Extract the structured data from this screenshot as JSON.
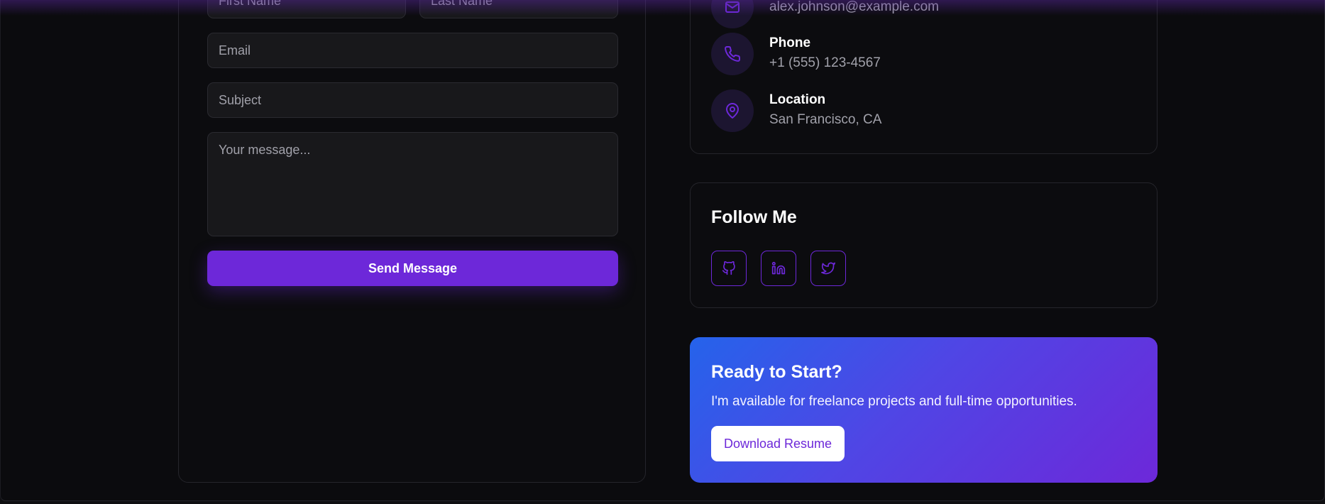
{
  "form": {
    "first_name_placeholder": "First Name",
    "last_name_placeholder": "Last Name",
    "email_placeholder": "Email",
    "subject_placeholder": "Subject",
    "message_placeholder": "Your message...",
    "submit_label": "Send Message"
  },
  "contact": {
    "email": {
      "icon": "mail-icon",
      "value": "alex.johnson@example.com"
    },
    "phone": {
      "icon": "phone-icon",
      "label": "Phone",
      "value": "+1 (555) 123-4567"
    },
    "location": {
      "icon": "map-pin-icon",
      "label": "Location",
      "value": "San Francisco, CA"
    }
  },
  "follow": {
    "title": "Follow Me",
    "links": [
      {
        "icon": "github-icon"
      },
      {
        "icon": "linkedin-icon"
      },
      {
        "icon": "twitter-icon"
      }
    ]
  },
  "cta": {
    "title": "Ready to Start?",
    "text": "I'm available for freelance projects and full-time opportunities.",
    "button_label": "Download Resume"
  },
  "colors": {
    "accent": "#6d28d9",
    "background": "#0b0b0e",
    "card_border": "#25252b",
    "muted_text": "#a1a1aa",
    "gradient_start": "#2563eb",
    "gradient_end": "#6d28d9"
  }
}
